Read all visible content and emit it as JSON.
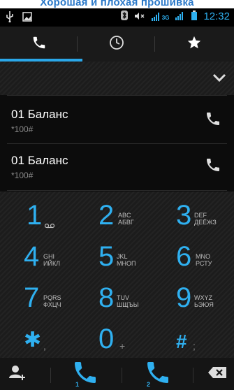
{
  "banner": {
    "text": "Хорошая и плохая прошивка"
  },
  "status_bar": {
    "network_label": "3G",
    "time": "12:32"
  },
  "tabs": [
    {
      "icon": "phone-icon",
      "selected": true
    },
    {
      "icon": "clock-icon",
      "selected": false
    },
    {
      "icon": "star-icon",
      "selected": false
    }
  ],
  "list": {
    "rows": [
      {
        "name": "01 Баланс",
        "number": "*100#"
      },
      {
        "name": "01 Баланс",
        "number": "*100#"
      }
    ]
  },
  "keypad": {
    "keys": [
      {
        "digit": "1",
        "letters": "",
        "sub": ""
      },
      {
        "digit": "2",
        "letters": "ABC\nАБВГ",
        "sub": ""
      },
      {
        "digit": "3",
        "letters": "DEF\nДЕЁЖЗ",
        "sub": ""
      },
      {
        "digit": "4",
        "letters": "GHI\nИЙКЛ",
        "sub": ""
      },
      {
        "digit": "5",
        "letters": "JKL\nМНОП",
        "sub": ""
      },
      {
        "digit": "6",
        "letters": "MNO\nРСТУ",
        "sub": ""
      },
      {
        "digit": "7",
        "letters": "PQRS\nФХЦЧ",
        "sub": ""
      },
      {
        "digit": "8",
        "letters": "TUV\nШЩЪЫ",
        "sub": ""
      },
      {
        "digit": "9",
        "letters": "WXYZ\nЬЭЮЯ",
        "sub": ""
      },
      {
        "digit": "✱",
        "letters": "",
        "sub": ","
      },
      {
        "digit": "0",
        "letters": "",
        "sub": "+"
      },
      {
        "digit": "#",
        "letters": "",
        "sub": ";"
      }
    ]
  },
  "bottom_bar": {
    "sim1_label": "1",
    "sim2_label": "2"
  },
  "colors": {
    "accent": "#2fb0f0",
    "tab_indicator": "#2aa7e8"
  }
}
